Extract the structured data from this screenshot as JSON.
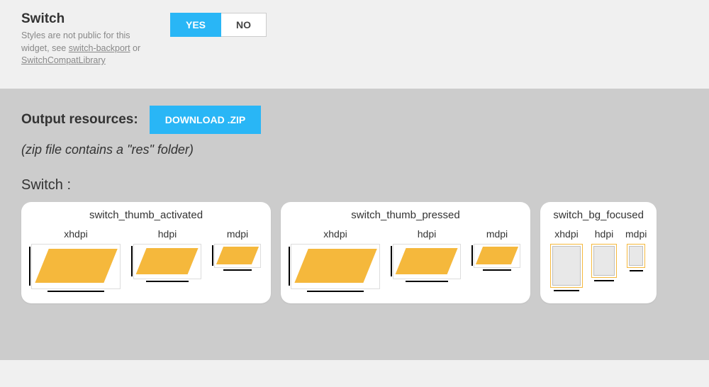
{
  "switch": {
    "title": "Switch",
    "desc_prefix": "Styles are not public for this widget, see ",
    "link1": "switch-backport",
    "desc_mid": " or ",
    "link2": "SwitchCompatLibrary"
  },
  "toggle": {
    "yes": "YES",
    "no": "NO"
  },
  "output": {
    "label": "Output resources:",
    "download": "DOWNLOAD .ZIP",
    "note": "(zip file contains a \"res\" folder)"
  },
  "section": {
    "switch_heading": "Switch :"
  },
  "cards": [
    {
      "title": "switch_thumb_activated",
      "type": "thumb",
      "densities": [
        "xhdpi",
        "hdpi",
        "mdpi"
      ]
    },
    {
      "title": "switch_thumb_pressed",
      "type": "thumb",
      "densities": [
        "xhdpi",
        "hdpi",
        "mdpi"
      ]
    },
    {
      "title": "switch_bg_focused",
      "type": "bg",
      "densities": [
        "xhdpi",
        "hdpi",
        "mdpi"
      ]
    }
  ],
  "density_labels": {
    "xhdpi": "xhdpi",
    "hdpi": "hdpi",
    "mdpi": "mdpi"
  },
  "colors": {
    "accent": "#29b6f6",
    "asset_fill": "#f5b83c"
  }
}
